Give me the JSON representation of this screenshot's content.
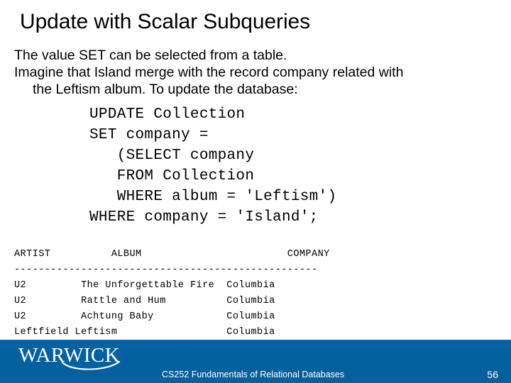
{
  "slide": {
    "title": "Update with Scalar Subqueries",
    "body": [
      "The value SET can be selected from a table.",
      "Imagine that Island merge with the record company related with",
      "the Leftism album. To update the database:"
    ],
    "sql": [
      "UPDATE Collection",
      "SET company =",
      "   (SELECT company",
      "   FROM Collection",
      "   WHERE album = 'Leftism')",
      "WHERE company = 'Island';"
    ],
    "result": {
      "header": "ARTIST          ALBUM                        COMPANY",
      "rule": "--------------------------------------------------",
      "columns": [
        "ARTIST",
        "ALBUM",
        "COMPANY"
      ],
      "rows": [
        [
          "U2",
          "The Unforgettable Fire",
          "Columbia"
        ],
        [
          "U2",
          "Rattle and Hum",
          "Columbia"
        ],
        [
          "U2",
          "Achtung Baby",
          "Columbia"
        ],
        [
          "Leftfield",
          "Leftism",
          "Columbia"
        ]
      ],
      "lines": [
        "U2         The Unforgettable Fire  Columbia",
        "U2         Rattle and Hum          Columbia",
        "U2         Achtung Baby            Columbia",
        "Leftfield Leftism                  Columbia"
      ]
    }
  },
  "footer": {
    "brand": "WARWICK",
    "caption": "CS252 Fundamentals of Relational Databases",
    "page_number": "56",
    "bar_color": "#01609f",
    "text_color": "#ffffff"
  }
}
